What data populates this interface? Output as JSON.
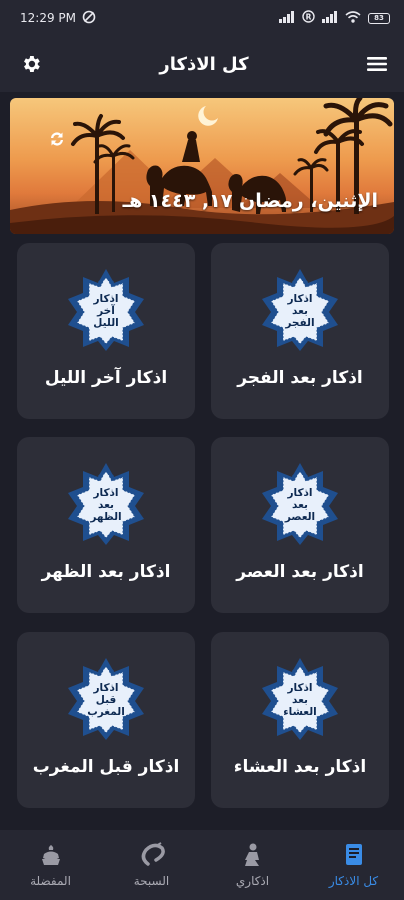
{
  "status": {
    "time": "12:29 PM",
    "battery": "83"
  },
  "header": {
    "title": "كل الاذكار",
    "settings_icon": "gear-icon",
    "menu_icon": "hamburger-menu-icon"
  },
  "banner": {
    "date": "الإثنين، رمضان ١٧, ١٤٤٣ هـ",
    "refresh_icon": "refresh-icon"
  },
  "cards": [
    {
      "title": "اذكار بعد الفجر",
      "badge": [
        "اذكار",
        "بعد",
        "الفجر"
      ]
    },
    {
      "title": "اذكار آخر الليل",
      "badge": [
        "اذكار",
        "آخر",
        "الليل"
      ]
    },
    {
      "title": "اذكار بعد العصر",
      "badge": [
        "اذكار",
        "بعد",
        "العصر"
      ]
    },
    {
      "title": "اذكار بعد الظهر",
      "badge": [
        "اذكار",
        "بعد",
        "الظهر"
      ]
    },
    {
      "title": "اذكار بعد العشاء",
      "badge": [
        "اذكار",
        "بعد",
        "العشاء"
      ]
    },
    {
      "title": "اذكار قبل المغرب",
      "badge": [
        "اذكار",
        "قبل",
        "المغرب"
      ]
    }
  ],
  "nav": [
    {
      "label": "كل الاذكار",
      "icon": "book-icon",
      "active": true
    },
    {
      "label": "اذكاري",
      "icon": "praying-person-icon",
      "active": false
    },
    {
      "label": "السبحة",
      "icon": "prayer-beads-icon",
      "active": false
    },
    {
      "label": "المفضلة",
      "icon": "favorites-icon",
      "active": false
    }
  ],
  "colors": {
    "background": "#1d1e28",
    "card": "#2d2e38",
    "accent": "#3a8ce6",
    "badge_blue": "#1f4f8f"
  }
}
